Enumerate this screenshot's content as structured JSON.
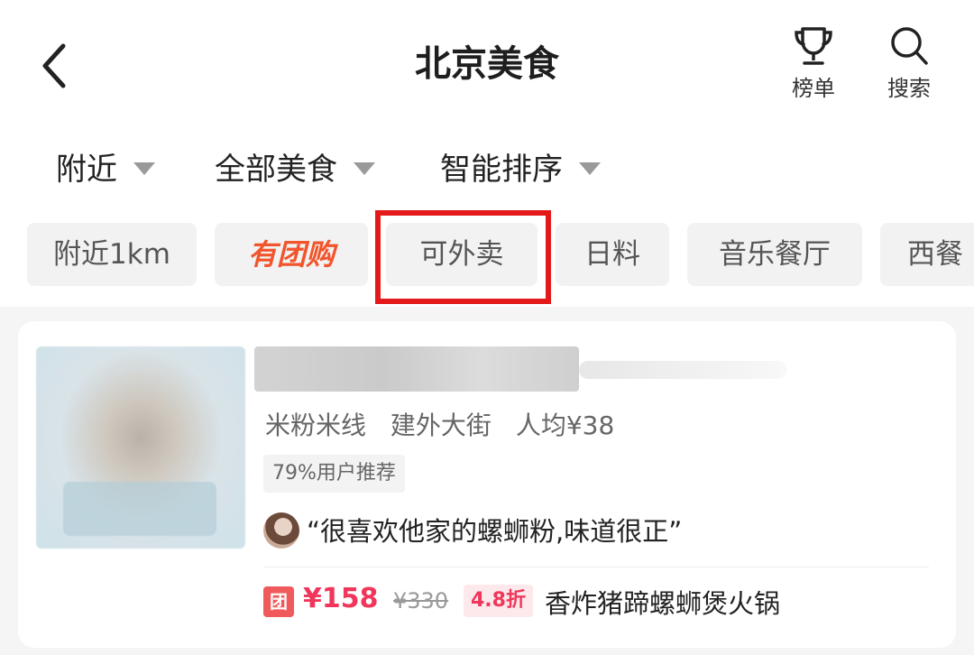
{
  "header": {
    "title": "北京美食",
    "rank_label": "榜单",
    "search_label": "搜索"
  },
  "filters": [
    {
      "label": "附近"
    },
    {
      "label": "全部美食"
    },
    {
      "label": "智能排序"
    }
  ],
  "chips": [
    {
      "label": "附近1km"
    },
    {
      "label": "有团购"
    },
    {
      "label": "可外卖"
    },
    {
      "label": "日料"
    },
    {
      "label": "音乐餐厅"
    },
    {
      "label": "西餐"
    }
  ],
  "listing": {
    "category": "米粉米线",
    "area": "建外大街",
    "avg_price": "人均¥38",
    "recommend": "79%用户推荐",
    "review": "“很喜欢他家的螺蛳粉,味道很正”",
    "deal": {
      "badge": "团",
      "price": "¥158",
      "original_price": "¥330",
      "discount": "4.8折",
      "name": "香炸猪蹄螺蛳煲火锅"
    }
  }
}
